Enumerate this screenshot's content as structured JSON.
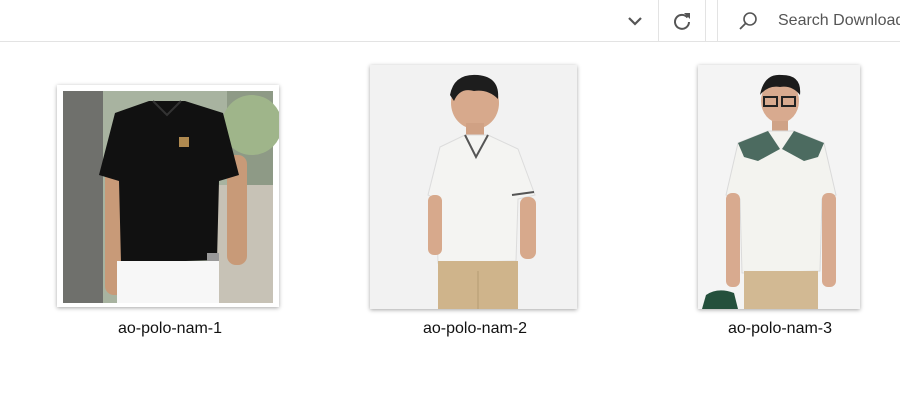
{
  "toolbar": {
    "dropdown_icon": "chevron-down-icon",
    "refresh_icon": "refresh-icon",
    "search_placeholder": "Search Downloads",
    "search_icon": "search-icon"
  },
  "files": [
    {
      "name": "ao-polo-nam-1",
      "shirt_color": "#111111"
    },
    {
      "name": "ao-polo-nam-2",
      "shirt_color": "#f4f4f2"
    },
    {
      "name": "ao-polo-nam-3",
      "shirt_color": "#f3f3ef",
      "collar_color": "#4c6b60"
    }
  ]
}
